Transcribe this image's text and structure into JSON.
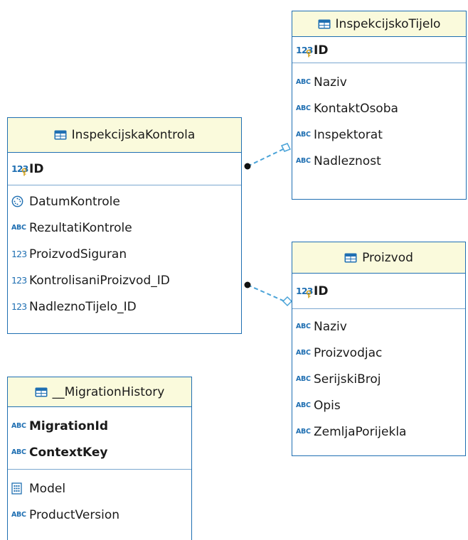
{
  "colors": {
    "border": "#1f6fb2",
    "header_bg": "#fafadc",
    "connector": "#4aa3d8",
    "icon": "#1f6fb2"
  },
  "entities": {
    "inspekcijsko_tijelo": {
      "title": "InspekcijskoTijelo",
      "pk": {
        "icon": "number-key-icon",
        "label": "ID"
      },
      "columns": [
        {
          "icon": "abc-icon",
          "label": "Naziv"
        },
        {
          "icon": "abc-icon",
          "label": "KontaktOsoba"
        },
        {
          "icon": "abc-icon",
          "label": "Inspektorat"
        },
        {
          "icon": "abc-icon",
          "label": "Nadleznost"
        }
      ]
    },
    "inspekcijska_kontrola": {
      "title": "InspekcijskaKontrola",
      "pk": {
        "icon": "number-key-icon",
        "label": "ID"
      },
      "columns": [
        {
          "icon": "clock-icon",
          "label": "DatumKontrole"
        },
        {
          "icon": "abc-icon",
          "label": "RezultatiKontrole"
        },
        {
          "icon": "number-icon",
          "label": "ProizvodSiguran"
        },
        {
          "icon": "number-icon",
          "label": "KontrolisaniProizvod_ID"
        },
        {
          "icon": "number-icon",
          "label": "NadleznoTijelo_ID"
        }
      ]
    },
    "proizvod": {
      "title": "Proizvod",
      "pk": {
        "icon": "number-key-icon",
        "label": "ID"
      },
      "columns": [
        {
          "icon": "abc-icon",
          "label": "Naziv"
        },
        {
          "icon": "abc-icon",
          "label": "Proizvodjac"
        },
        {
          "icon": "abc-icon",
          "label": "SerijskiBroj"
        },
        {
          "icon": "abc-icon",
          "label": "Opis"
        },
        {
          "icon": "abc-icon",
          "label": "ZemljaPorijekla"
        }
      ]
    },
    "migration_history": {
      "title": "__MigrationHistory",
      "keys": [
        {
          "icon": "abc-icon",
          "label": "MigrationId"
        },
        {
          "icon": "abc-icon",
          "label": "ContextKey"
        }
      ],
      "columns": [
        {
          "icon": "binary-icon",
          "label": "Model"
        },
        {
          "icon": "abc-icon",
          "label": "ProductVersion"
        }
      ]
    }
  },
  "icons": {
    "abc": "ABC",
    "num": "123"
  },
  "relationships": [
    {
      "from": "InspekcijskaKontrola",
      "to": "InspekcijskoTijelo"
    },
    {
      "from": "InspekcijskaKontrola",
      "to": "Proizvod"
    }
  ]
}
